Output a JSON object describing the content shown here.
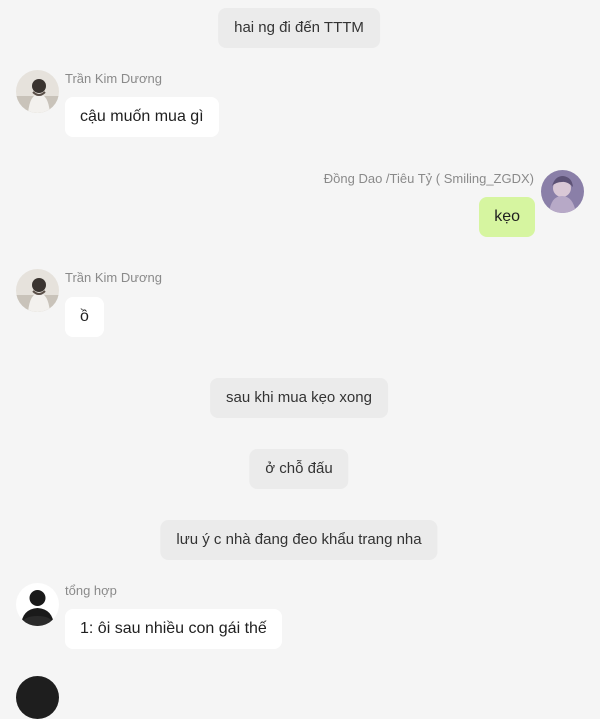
{
  "colors": {
    "background": "#f5f5f5",
    "system_pill": "#ebebeb",
    "bubble_incoming": "#ffffff",
    "bubble_outgoing": "#d6f5a0",
    "sender_name": "#8a8a8a",
    "scroll_indicator": "#2b8ce8"
  },
  "messages": {
    "sys_1": "hai ng đi đến TTTM",
    "msg_1": {
      "sender": "Trần Kim Dương",
      "text": "cậu muốn mua gì",
      "avatar": "user-avatar-1"
    },
    "msg_2": {
      "sender": "Đồng Dao /Tiêu Tỷ ( Smiling_ZGDX)",
      "text": "kẹo",
      "avatar": "user-avatar-2"
    },
    "msg_3": {
      "sender": "Trần Kim Dương",
      "text": "ồ",
      "avatar": "user-avatar-1"
    },
    "sys_2": "sau khi mua kẹo xong",
    "sys_3": "ở chỗ  đấu",
    "sys_4": "lưu ý c nhà đang đeo khẩu trang nha",
    "msg_4": {
      "sender": "tổng hợp",
      "text": "1: ôi sau nhiều con gái thế",
      "avatar": "silhouette-avatar"
    }
  }
}
